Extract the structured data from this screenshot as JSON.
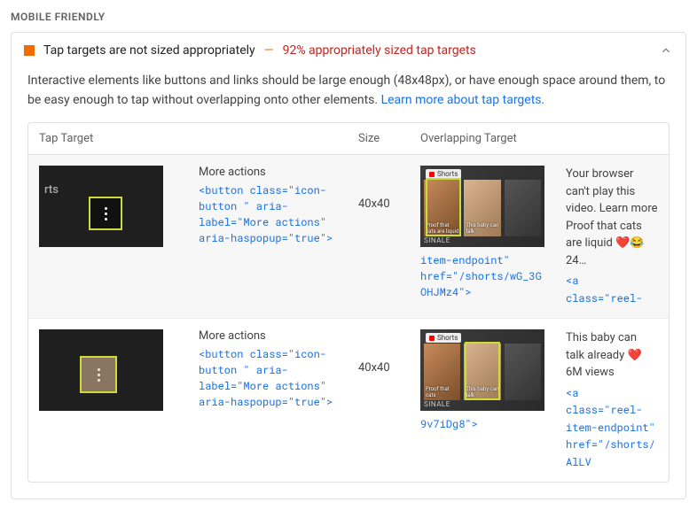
{
  "section_label": "MOBILE FRIENDLY",
  "audit": {
    "title": "Tap targets are not sized appropriately",
    "dash": "—",
    "subtitle": "92% appropriately sized tap targets",
    "description_pre": "Interactive elements like buttons and links should be large enough (48x48px), or have enough space around them, to be easy enough to tap without overlapping onto other elements. ",
    "learn_more": "Learn more about tap targets."
  },
  "columns": {
    "tap_target": "Tap Target",
    "size": "Size",
    "overlapping": "Overlapping Target"
  },
  "rows": [
    {
      "tap_thumb_label": "rts",
      "node_label": "More actions",
      "node_code": "<button class=\"icon-button \" aria-label=\"More actions\" aria-haspopup=\"true\">",
      "size": "40x40",
      "ot_pre_text": "Your browser can't play this video. Learn more Proof that cats are liquid ❤️😂 24…",
      "ot_code": "<a class=\"reel-item-endpoint\" href=\"/shorts/wG_3GOHJMz4\">",
      "shorts_caption1": "Proof that cats are liquid",
      "shorts_caption2": "This baby can talk",
      "shorts_chip": "Shorts",
      "finals": "SINALE",
      "hl_index": 0
    },
    {
      "tap_thumb_label": "",
      "node_label": "More actions",
      "node_code": "<button class=\"icon-button \" aria-label=\"More actions\" aria-haspopup=\"true\">",
      "size": "40x40",
      "ot_pre_text": "This baby can talk already ❤️ 6M views",
      "ot_code": "<a class=\"reel-item-endpoint\" href=\"/shorts/AlLV9v7iDg8\">",
      "shorts_caption1": "Proof that cats",
      "shorts_caption2": "This baby can talk",
      "shorts_chip": "Shorts",
      "finals": "SINALE",
      "hl_index": 1
    }
  ]
}
